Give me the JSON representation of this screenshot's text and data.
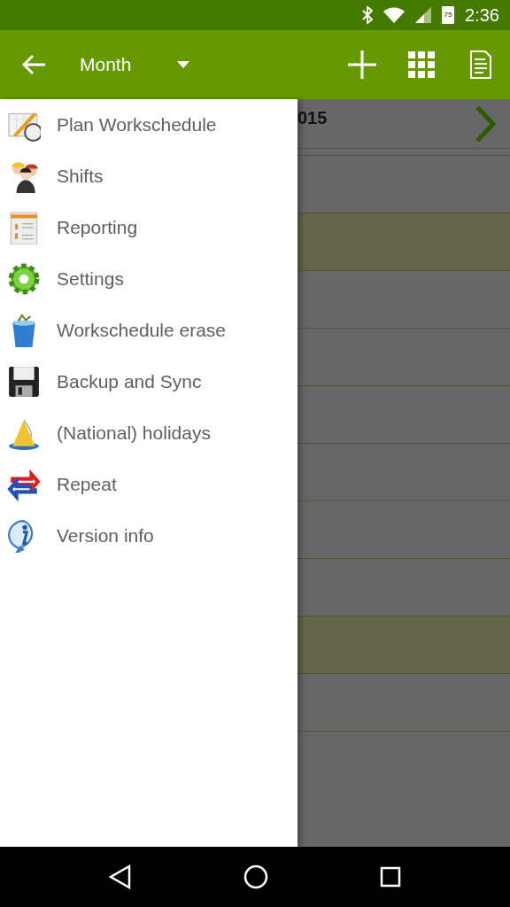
{
  "status_bar": {
    "battery": "75",
    "time": "2:36"
  },
  "toolbar": {
    "view": "Month"
  },
  "calendar": {
    "header": "015",
    "rows": [
      {
        "highlighted": false
      },
      {
        "highlighted": true
      },
      {
        "highlighted": false
      },
      {
        "highlighted": false
      },
      {
        "highlighted": false
      },
      {
        "highlighted": false
      },
      {
        "highlighted": false
      },
      {
        "highlighted": false
      },
      {
        "highlighted": true
      },
      {
        "highlighted": false
      },
      {
        "highlighted": false
      }
    ]
  },
  "drawer": {
    "items": [
      {
        "label": "Plan Workschedule"
      },
      {
        "label": "Shifts"
      },
      {
        "label": "Reporting"
      },
      {
        "label": "Settings"
      },
      {
        "label": "Workschedule erase"
      },
      {
        "label": "Backup and Sync"
      },
      {
        "label": "(National) holidays"
      },
      {
        "label": "Repeat"
      },
      {
        "label": "Version info"
      }
    ]
  }
}
